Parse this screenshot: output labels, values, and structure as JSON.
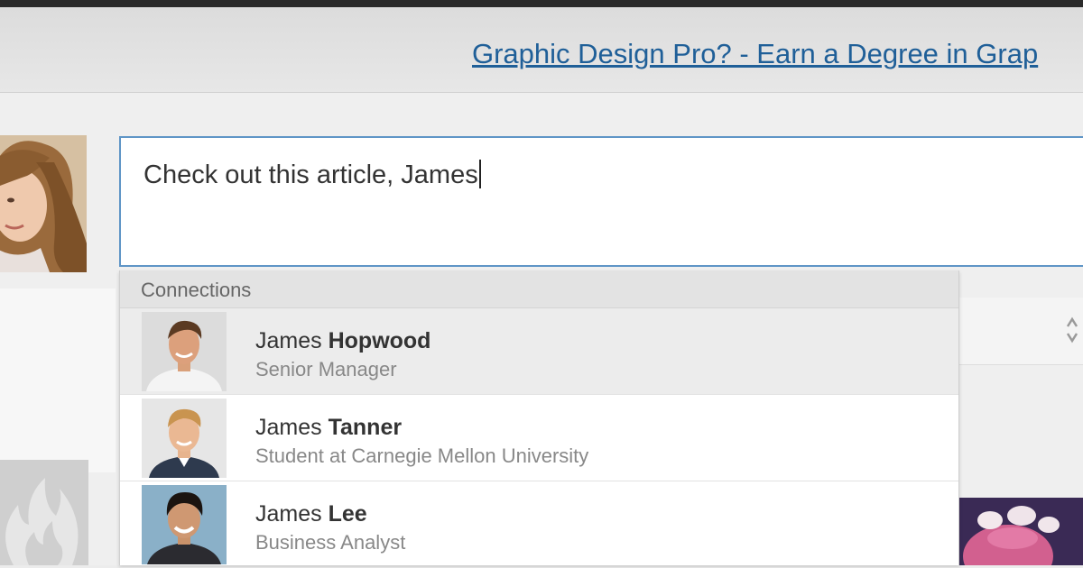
{
  "ad": {
    "link_text": "Graphic Design Pro? - Earn a Degree in Grap"
  },
  "compose": {
    "text": "Check out this article, James"
  },
  "mentions": {
    "header": "Connections",
    "items": [
      {
        "first": "James",
        "last": "Hopwood",
        "title": "Senior Manager",
        "highlighted": true
      },
      {
        "first": "James",
        "last": "Tanner",
        "title": "Student at Carnegie Mellon University",
        "highlighted": false
      },
      {
        "first": "James",
        "last": "Lee",
        "title": "Business Analyst",
        "highlighted": false
      }
    ]
  },
  "colors": {
    "link": "#1f5f98",
    "focus_border": "#5f95c6",
    "highlight_row": "#ececec"
  },
  "icons": [
    "flame-icon",
    "spinner-arrows-icon"
  ]
}
